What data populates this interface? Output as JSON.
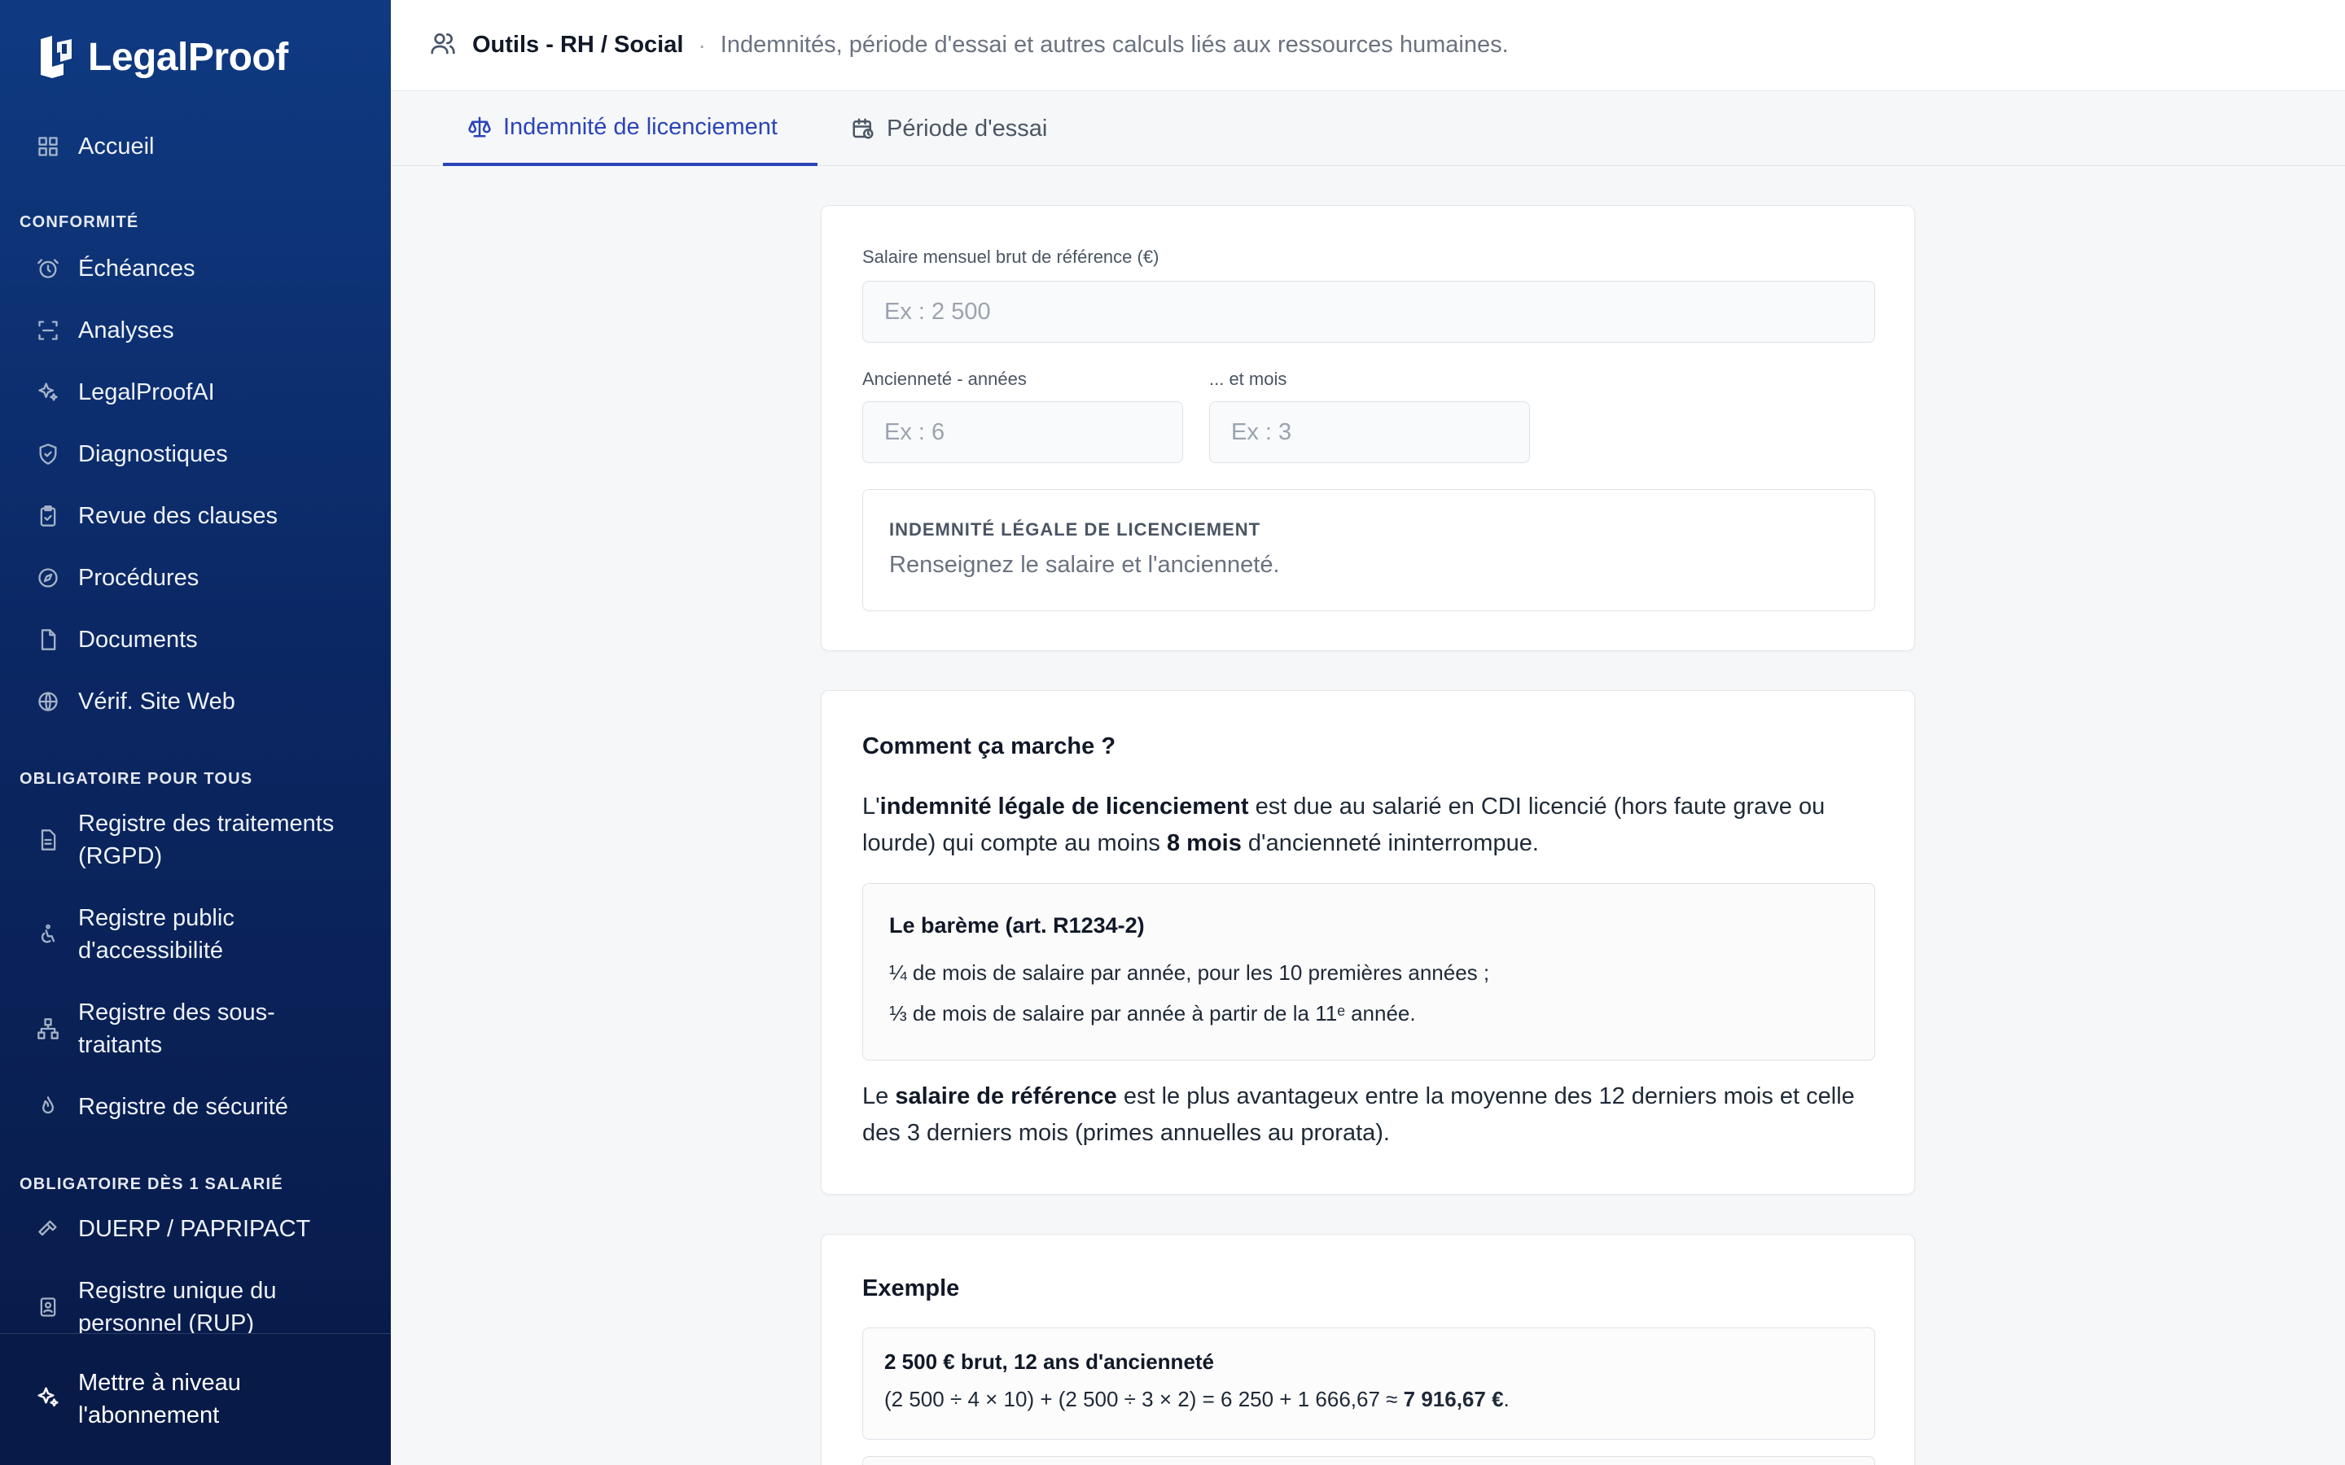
{
  "app": {
    "name": "LegalProof"
  },
  "sidebar": {
    "home": "Accueil",
    "sections": {
      "conformite": "CONFORMITÉ",
      "obligatoire": "OBLIGATOIRE POUR TOUS",
      "salarie": "OBLIGATOIRE DÈS 1 SALARIÉ"
    },
    "conformite_items": [
      "Échéances",
      "Analyses",
      "LegalProofAI",
      "Diagnostiques",
      "Revue des clauses",
      "Procédures",
      "Documents",
      "Vérif. Site Web"
    ],
    "obligatoire_items": [
      [
        "Registre des traitements",
        "(RGPD)"
      ],
      [
        "Registre public",
        "d'accessibilité"
      ],
      [
        "Registre des sous-",
        "traitants"
      ],
      [
        "Registre de sécurité"
      ]
    ],
    "salarie_items": [
      [
        "DUERP / PAPRIPACT"
      ],
      [
        "Registre unique du",
        "personnel (RUP)"
      ]
    ],
    "upgrade": [
      "Mettre à niveau",
      "l'abonnement"
    ]
  },
  "header": {
    "title": "Outils - RH / Social",
    "separator": "·",
    "subtitle": "Indemnités, période d'essai et autres calculs liés aux ressources humaines."
  },
  "tabs": [
    {
      "label": "Indemnité de licenciement",
      "active": true
    },
    {
      "label": "Période d'essai",
      "active": false
    }
  ],
  "form": {
    "salary_label": "Salaire mensuel brut de référence (€)",
    "salary_placeholder": "Ex : 2 500",
    "years_label": "Ancienneté - années",
    "years_placeholder": "Ex : 6",
    "months_label": "... et mois",
    "months_placeholder": "Ex : 3",
    "result_caption": "INDEMNITÉ LÉGALE DE LICENCIEMENT",
    "result_message": "Renseignez le salaire et l'ancienneté."
  },
  "how": {
    "title": "Comment ça marche ?",
    "p1_a": "L'",
    "p1_b": "indemnité légale de licenciement",
    "p1_c": " est due au salarié en CDI licencié (hors faute grave ou lourde) qui compte au moins ",
    "p1_d": "8 mois",
    "p1_e": " d'ancienneté ininterrompue.",
    "bareme_title": "Le barème (art. R1234-2)",
    "bareme_line1": "¼ de mois de salaire par année, pour les 10 premières années ;",
    "bareme_line2": "⅓ de mois de salaire par année à partir de la 11ᵉ année.",
    "p2_a": "Le ",
    "p2_b": "salaire de référence",
    "p2_c": " est le plus avantageux entre la moyenne des 12 derniers mois et celle des 3 derniers mois (primes annuelles au prorata)."
  },
  "example": {
    "title": "Exemple",
    "case_title": "2 500 € brut, 12 ans d'ancienneté",
    "formula": "(2 500 ÷ 4 × 10) + (2 500 ÷ 3 × 2) = 6 250 + 1 666,67 ≈ ",
    "result": "7 916,67 €",
    "end": "."
  }
}
